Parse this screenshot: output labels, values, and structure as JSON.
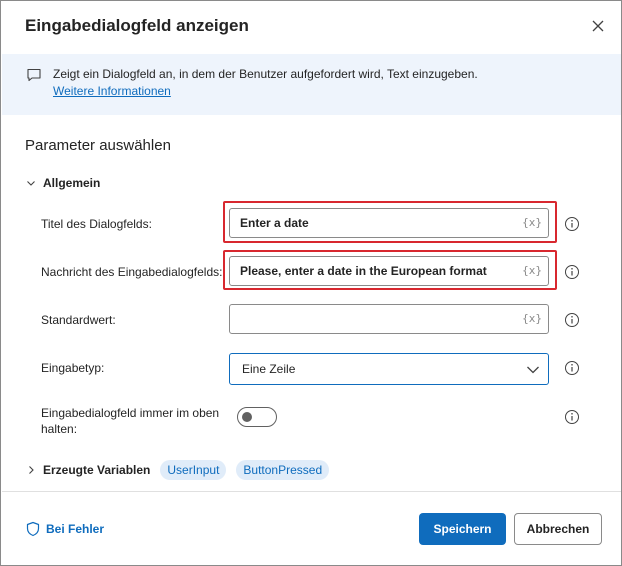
{
  "dialog": {
    "title": "Eingabedialogfeld anzeigen",
    "close_icon": "close-icon"
  },
  "banner": {
    "icon": "message-icon",
    "description": "Zeigt ein Dialogfeld an, in dem der Benutzer aufgefordert wird, Text einzugeben.",
    "link": "Weitere Informationen"
  },
  "parameters": {
    "heading": "Parameter auswählen",
    "group_label": "Allgemein",
    "title_field": {
      "label": "Titel des Dialogfelds:",
      "value": "Enter a date",
      "var_icon": "{x}"
    },
    "message_field": {
      "label": "Nachricht des Eingabedialogfelds:",
      "value": "Please, enter a date in the European format",
      "var_icon": "{x}"
    },
    "default_field": {
      "label": "Standardwert:",
      "value": "",
      "var_icon": "{x}"
    },
    "input_type": {
      "label": "Eingabetyp:",
      "value": "Eine Zeile"
    },
    "keep_on_top": {
      "label_line1": "Eingabedialogfeld immer im oben",
      "label_line2": "halten:",
      "state": "off"
    }
  },
  "variables": {
    "label": "Erzeugte Variablen",
    "chips": [
      "UserInput",
      "ButtonPressed"
    ]
  },
  "footer": {
    "error_label": "Bei Fehler",
    "save_label": "Speichern",
    "cancel_label": "Abbrechen"
  },
  "colors": {
    "accent": "#0f6cbd",
    "highlight": "#d8282f",
    "banner_bg": "#eef4fc"
  }
}
